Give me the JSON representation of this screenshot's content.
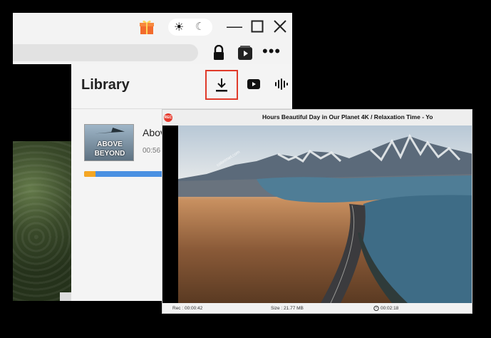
{
  "browser": {
    "icons": {
      "gift": "gift-icon",
      "theme_light": "sun-icon",
      "theme_dark": "moon-icon",
      "minimize": "minimize-icon",
      "maximize": "maximize-icon",
      "close": "close-icon",
      "lock": "lock-icon",
      "extension": "extension-icon",
      "menu": "more-dots-icon"
    }
  },
  "library": {
    "title": "Library",
    "tabs": [
      "download",
      "video",
      "audio"
    ],
    "active_tab": "download",
    "item": {
      "title": "Abov",
      "time": "00:56",
      "thumb_line1": "ABOVE",
      "thumb_line2": "BEYOND",
      "progress_fraction": 1.0
    }
  },
  "recorder": {
    "badge": "REC",
    "title": "Hours Beautiful Day in Our Planet 4K / Relaxation Time - Yo",
    "watermark": "colorimet.com",
    "status": {
      "elapsed": "Rec : 00:00:42",
      "size": "Size : 21.77 MB",
      "timer": "00:02:18"
    }
  },
  "colors": {
    "accent_red": "#e03a2a",
    "progress_blue": "#4a90e2",
    "progress_orange": "#f5a623",
    "gift": "#f26b2c"
  }
}
